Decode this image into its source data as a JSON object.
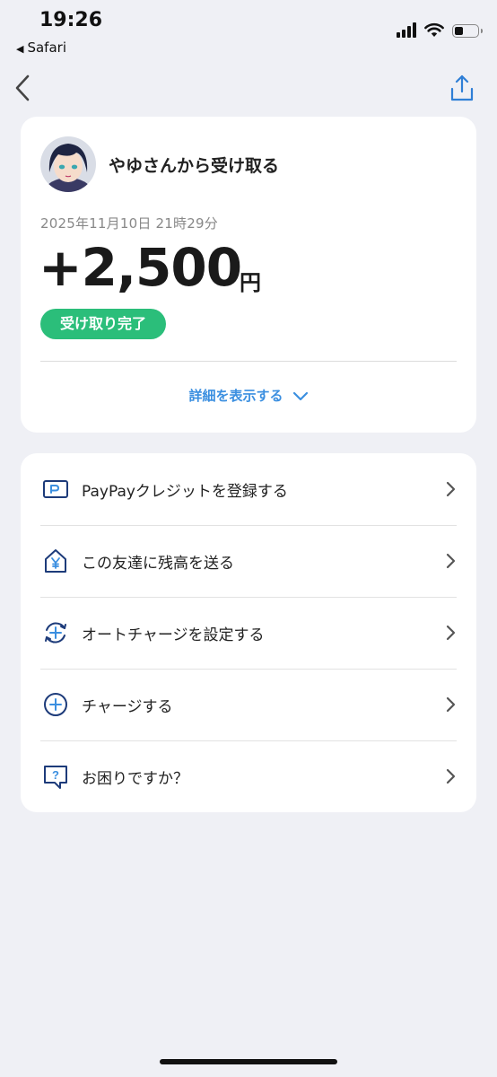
{
  "status_bar": {
    "time": "19:26",
    "back_app": "Safari"
  },
  "transaction": {
    "title": "やゆさんから受け取る",
    "date": "2025年11月10日 21時29分",
    "amount": "+2,500",
    "currency": "円",
    "status": "受け取り完了",
    "detail_link": "詳細を表示する"
  },
  "menu": {
    "items": [
      {
        "label": "PayPayクレジットを登録する",
        "icon": "card-icon"
      },
      {
        "label": "この友達に残高を送る",
        "icon": "house-yen-icon"
      },
      {
        "label": "オートチャージを設定する",
        "icon": "auto-charge-icon"
      },
      {
        "label": "チャージする",
        "icon": "plus-circle-icon"
      },
      {
        "label": "お困りですか？",
        "icon": "help-bubble-icon"
      }
    ]
  },
  "colors": {
    "accent_green": "#2bbe7a",
    "link_blue": "#3b8fe0",
    "icon_navy": "#1d3b7a",
    "background": "#eff0f5"
  }
}
